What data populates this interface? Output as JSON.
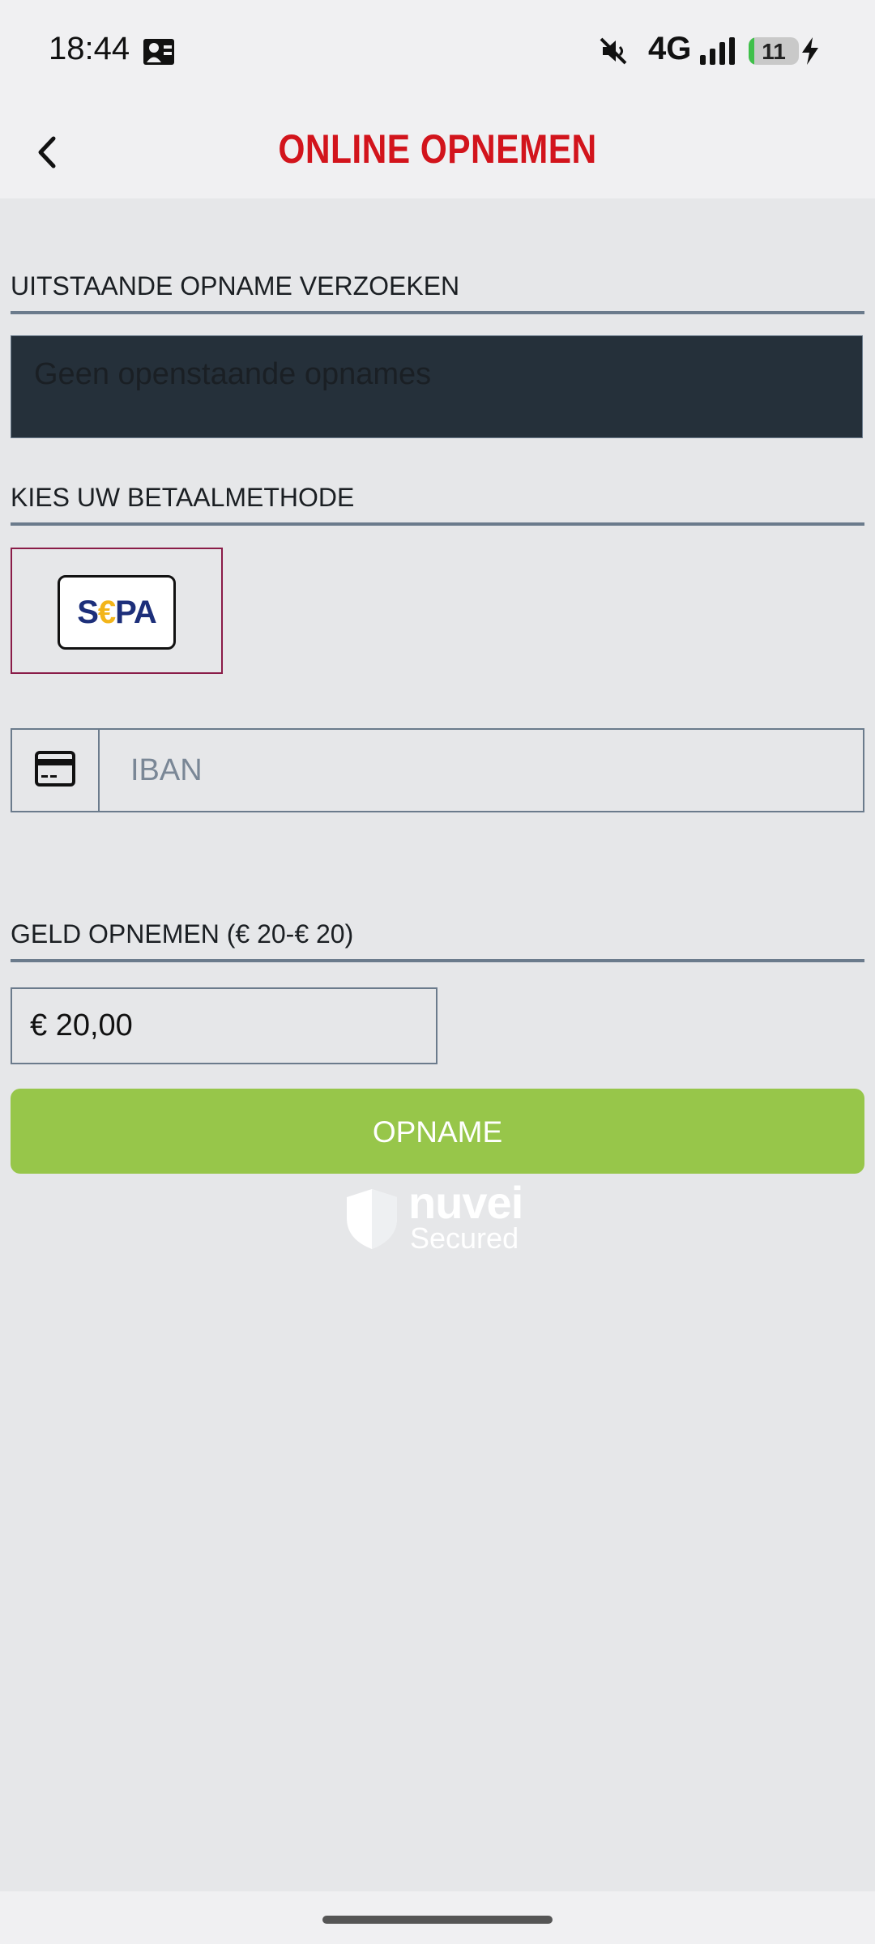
{
  "status_bar": {
    "time": "18:44",
    "network": "4G",
    "battery_level": "11",
    "battery_fraction": 0.11,
    "icons": [
      "contact-card-icon",
      "mute-icon",
      "signal-icon",
      "battery-icon",
      "charging-icon"
    ]
  },
  "header": {
    "title": "ONLINE OPNEMEN",
    "back_icon": "chevron-left-icon"
  },
  "pending": {
    "label": "UITSTAANDE OPNAME VERZOEKEN",
    "empty_text": "Geen openstaande opnames"
  },
  "payment": {
    "label": "KIES UW BETAALMETHODE",
    "methods": [
      {
        "name": "SEPA",
        "logo_text": [
          "S",
          "€",
          "PA"
        ],
        "selected": true
      }
    ]
  },
  "iban": {
    "icon": "credit-card-icon",
    "placeholder": "IBAN",
    "value": ""
  },
  "withdraw": {
    "label": "GELD OPNEMEN (€ 20-€ 20)",
    "amount_value": "€ 20,00",
    "button_label": "OPNAME"
  },
  "secured": {
    "brand": "nuvei",
    "subtitle": "Secured",
    "icon": "shield-icon"
  },
  "colors": {
    "title_red": "#d2141c",
    "button_green": "#97c64a",
    "pending_box": "#25303a",
    "divider": "#6b7b8c",
    "selected_border": "#8a1c48",
    "background": "#e6e7e9"
  }
}
